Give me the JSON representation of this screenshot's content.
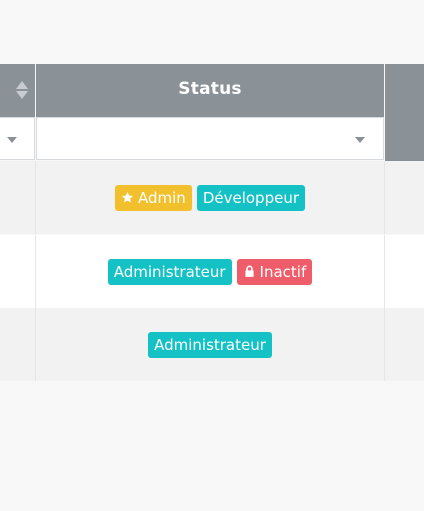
{
  "table": {
    "header": {
      "status_label": "Status"
    },
    "rows": [
      {
        "badges": [
          {
            "label": "Admin",
            "icon": "star-icon",
            "color": "#f3c02d"
          },
          {
            "label": "Développeur",
            "color": "#14c2c6"
          }
        ]
      },
      {
        "badges": [
          {
            "label": "Administrateur",
            "color": "#14c2c6"
          },
          {
            "label": "Inactif",
            "icon": "lock-icon",
            "color": "#ef5d6a"
          }
        ]
      },
      {
        "badges": [
          {
            "label": "Administrateur",
            "color": "#14c2c6"
          }
        ]
      }
    ]
  },
  "colors": {
    "header_bg": "#8a9197",
    "page_bg": "#f8f8f8",
    "row_alt_bg": "#f2f2f2"
  }
}
